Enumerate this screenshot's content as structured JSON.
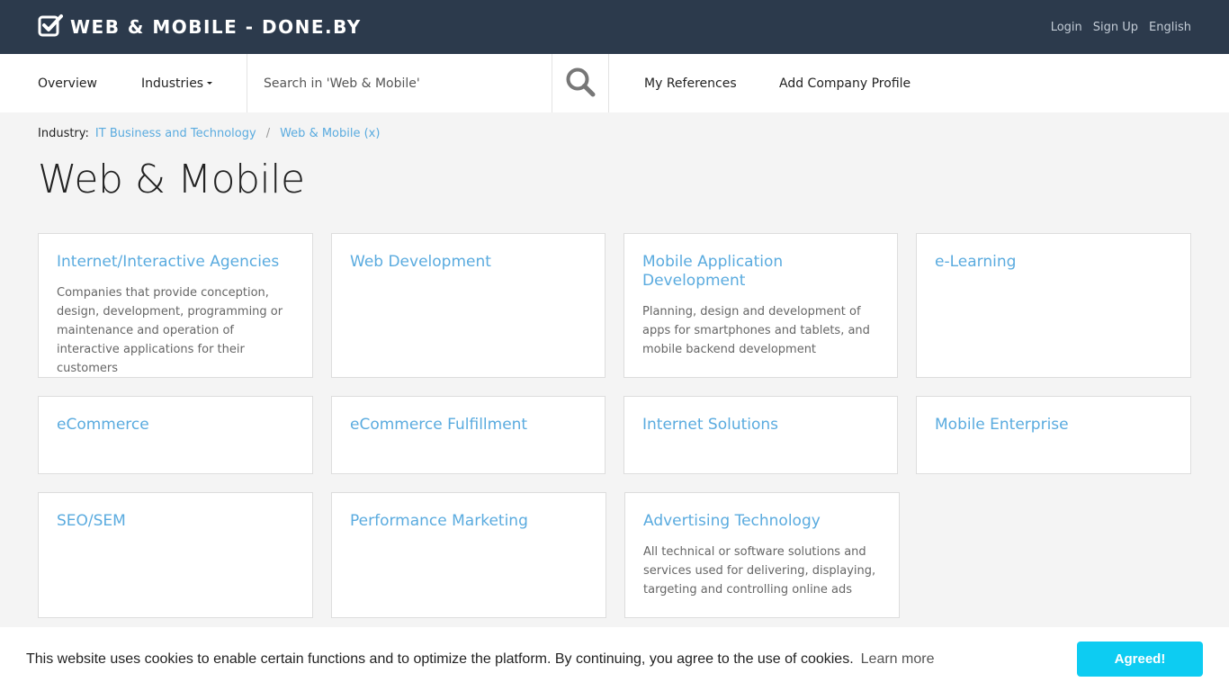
{
  "header": {
    "brand": "WEB & MOBILE - DONE.BY",
    "links": [
      {
        "label": "Login"
      },
      {
        "label": "Sign Up"
      },
      {
        "label": "English"
      }
    ]
  },
  "nav": {
    "overview": "Overview",
    "industries": "Industries",
    "search_placeholder": "Search in 'Web & Mobile'",
    "my_references": "My References",
    "add_company": "Add Company Profile"
  },
  "breadcrumb": {
    "label": "Industry:",
    "items": [
      "IT Business and Technology",
      "Web & Mobile (x)"
    ],
    "separator": "/"
  },
  "page_title": "Web & Mobile",
  "cards": [
    {
      "title": "Internet/Interactive Agencies",
      "desc": "Companies that provide conception, design, development, programming or maintenance and operation of interactive applications for their customers"
    },
    {
      "title": "Web Development",
      "desc": ""
    },
    {
      "title": "Mobile Application Development",
      "desc": "Planning, design and development of apps for smartphones and tablets, and mobile backend development"
    },
    {
      "title": "e-Learning",
      "desc": ""
    },
    {
      "title": "eCommerce",
      "desc": ""
    },
    {
      "title": "eCommerce Fulfillment",
      "desc": ""
    },
    {
      "title": "Internet Solutions",
      "desc": ""
    },
    {
      "title": "Mobile Enterprise",
      "desc": ""
    },
    {
      "title": "SEO/SEM",
      "desc": ""
    },
    {
      "title": "Performance Marketing",
      "desc": ""
    },
    {
      "title": "Advertising Technology",
      "desc": "All technical or software solutions and services used for delivering, displaying, targeting and controlling online ads"
    }
  ],
  "cookie": {
    "text": "This website uses cookies to enable certain functions and to optimize the platform. By continuing, you agree to the use of cookies.",
    "learn_more": "Learn more",
    "button": "Agreed!"
  },
  "colors": {
    "topbar": "#2c3a4c",
    "link": "#5aabdf",
    "cookie_button": "#0dccf2"
  }
}
